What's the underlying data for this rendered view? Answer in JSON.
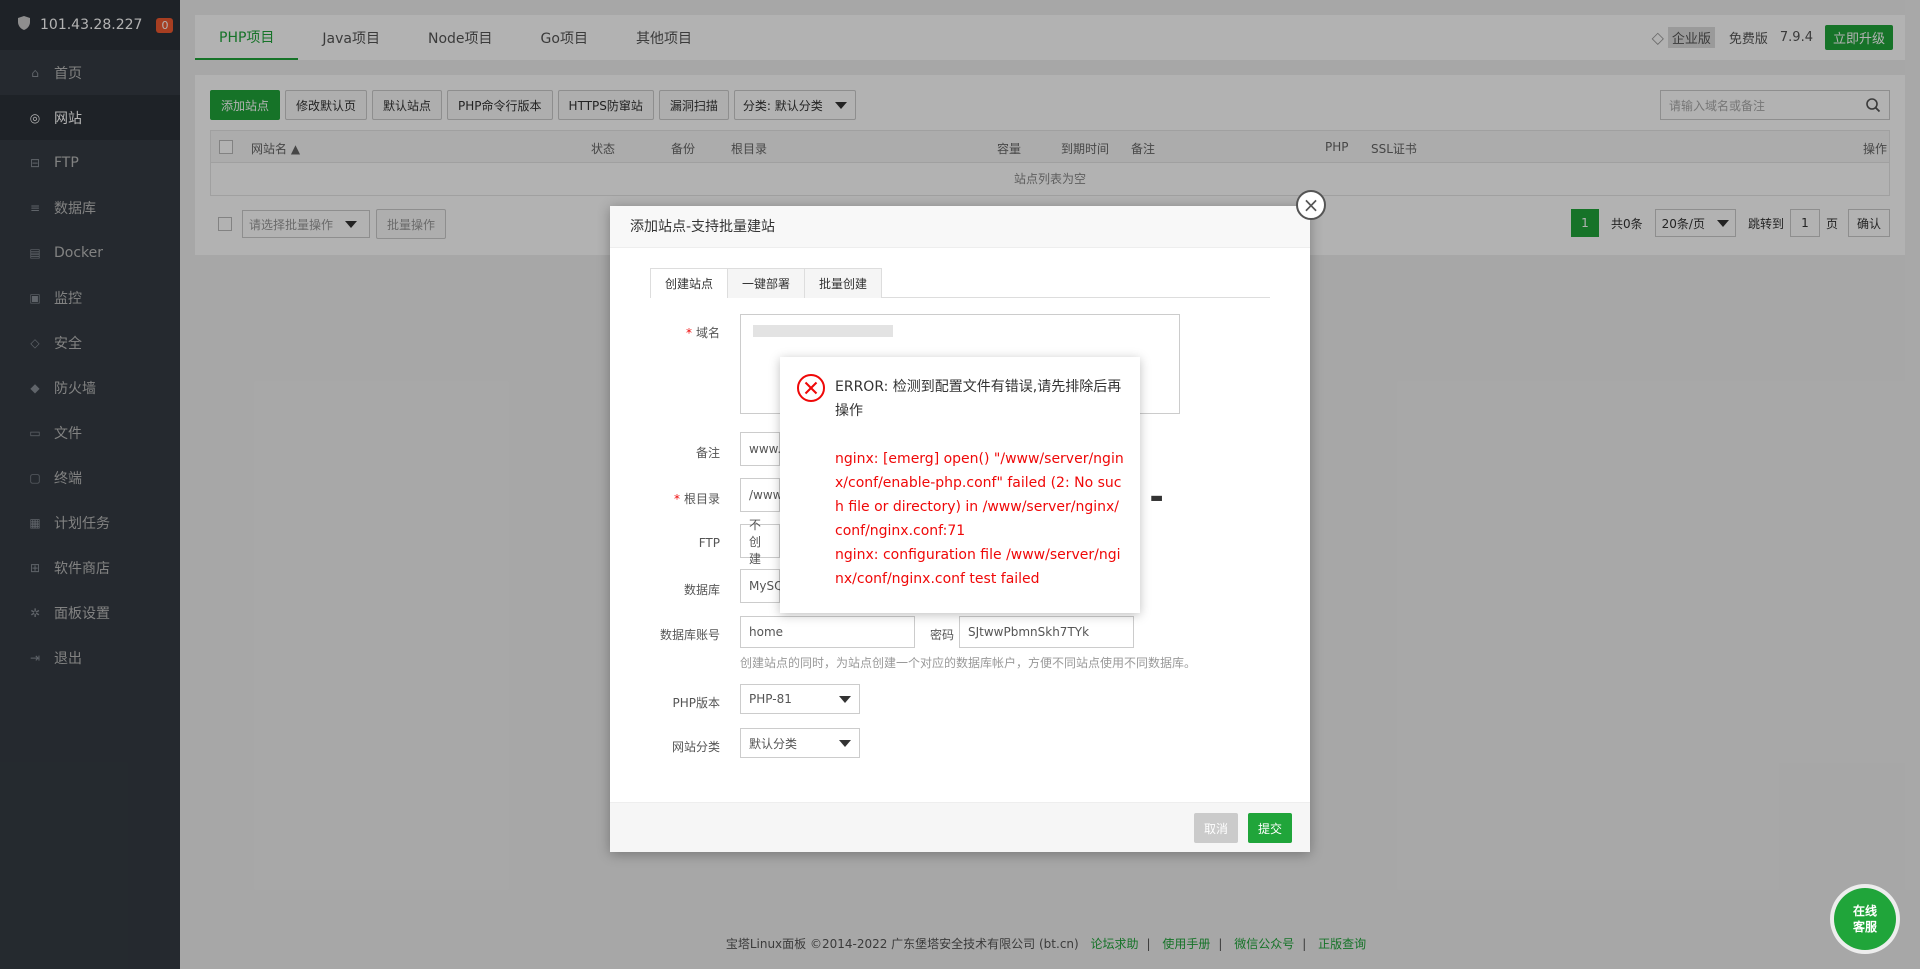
{
  "sidebar": {
    "ip": "101.43.28.227",
    "badge": "0",
    "items": [
      {
        "label": "首页",
        "icon": "home-icon"
      },
      {
        "label": "网站",
        "icon": "globe-icon",
        "active": true
      },
      {
        "label": "FTP",
        "icon": "ftp-icon"
      },
      {
        "label": "数据库",
        "icon": "database-icon"
      },
      {
        "label": "Docker",
        "icon": "docker-icon"
      },
      {
        "label": "监控",
        "icon": "monitor-icon"
      },
      {
        "label": "安全",
        "icon": "shield-icon"
      },
      {
        "label": "防火墙",
        "icon": "firewall-icon"
      },
      {
        "label": "文件",
        "icon": "folder-icon"
      },
      {
        "label": "终端",
        "icon": "terminal-icon"
      },
      {
        "label": "计划任务",
        "icon": "calendar-icon"
      },
      {
        "label": "软件商店",
        "icon": "apps-icon"
      },
      {
        "label": "面板设置",
        "icon": "gear-icon"
      },
      {
        "label": "退出",
        "icon": "logout-icon"
      }
    ]
  },
  "topbar": {
    "tabs": [
      "PHP项目",
      "Java项目",
      "Node项目",
      "Go项目",
      "其他项目"
    ],
    "enterprise_label": "企业版",
    "free_label": "免费版",
    "version": "7.9.4",
    "upgrade_label": "立即升级"
  },
  "toolbar": {
    "add_site": "添加站点",
    "edit_default": "修改默认页",
    "default_site": "默认站点",
    "php_cli": "PHP命令行版本",
    "https_guard": "HTTPS防窜站",
    "vuln_scan": "漏洞扫描",
    "category": "分类: 默认分类",
    "search_placeholder": "请输入域名或备注"
  },
  "table": {
    "headers": {
      "name": "网站名 ▲",
      "status": "状态",
      "backup": "备份",
      "root": "根目录",
      "capacity": "容量",
      "expire": "到期时间",
      "remark": "备注",
      "php": "PHP",
      "ssl": "SSL证书",
      "action": "操作"
    },
    "empty": "站点列表为空",
    "batch_placeholder": "请选择批量操作",
    "batch_button": "批量操作"
  },
  "pager": {
    "current": "1",
    "total": "共0条",
    "per_page": "20条/页",
    "jump_label": "跳转到",
    "jump_value": "1",
    "page_label": "页",
    "confirm": "确认"
  },
  "dialog": {
    "title": "添加站点-支持批量建站",
    "tabs": [
      "创建站点",
      "一键部署",
      "批量创建"
    ],
    "labels": {
      "domain": "域名",
      "remark": "备注",
      "root": "根目录",
      "ftp": "FTP",
      "database": "数据库",
      "db_account": "数据库账号",
      "password": "密码",
      "php_version": "PHP版本",
      "category": "网站分类"
    },
    "values": {
      "remark": "www.",
      "root": "/www",
      "ftp": "不创建",
      "database": "MySQ",
      "db_account": "home",
      "password": "SJtwwPbmnSkh7TYk",
      "php_version": "PHP-81",
      "category": "默认分类"
    },
    "hint": "创建站点的同时，为站点创建一个对应的数据库帐户，方便不同站点使用不同数据库。",
    "cancel": "取消",
    "submit": "提交"
  },
  "error": {
    "title": "ERROR: 检测到配置文件有错误,请先排除后再操作",
    "body1": "nginx: [emerg] open() \"/www/server/nginx/conf/enable-php.conf\" failed (2: No such file or directory) in /www/server/nginx/conf/nginx.conf:71",
    "body2": "nginx: configuration file /www/server/nginx/conf/nginx.conf test failed"
  },
  "footer": {
    "copyright": "宝塔Linux面板 ©2014-2022 广东堡塔安全技术有限公司 (bt.cn)",
    "links": [
      "论坛求助",
      "使用手册",
      "微信公众号",
      "正版查询"
    ]
  },
  "service": {
    "line1": "在线",
    "line2": "客服"
  },
  "colors": {
    "accent": "#20a53a",
    "error": "#ef0808",
    "sidebar": "#353c44"
  }
}
